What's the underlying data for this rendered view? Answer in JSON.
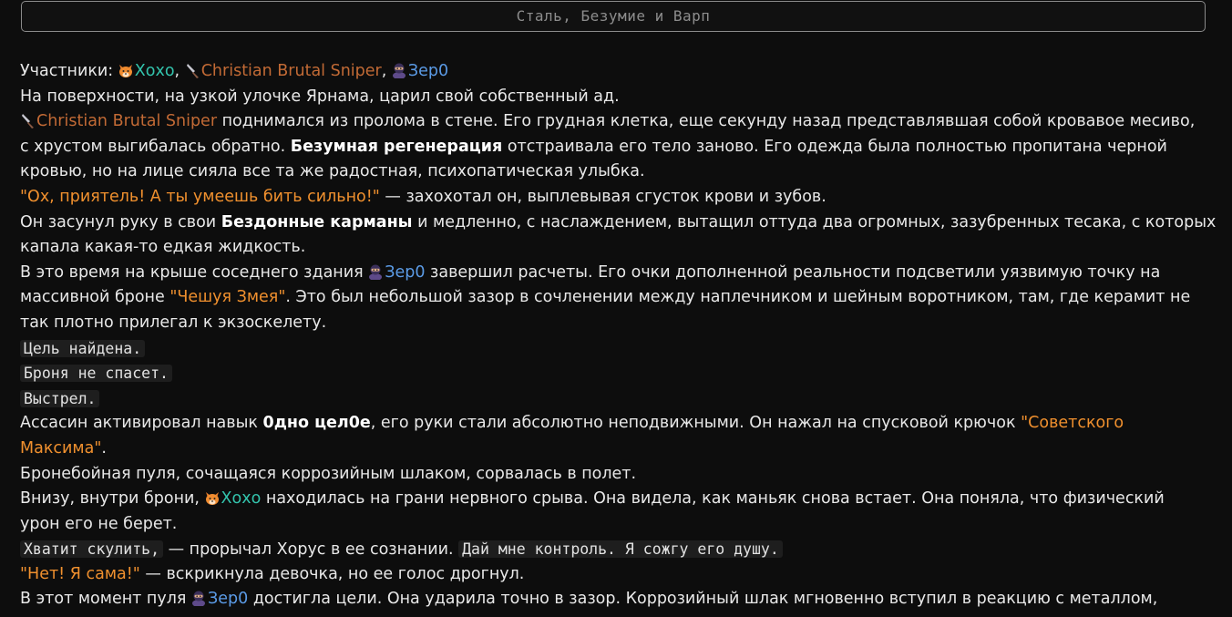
{
  "title": "Сталь, Безумие и Варп",
  "colors": {
    "teal": "#33c4ad",
    "brown": "#c26a35",
    "blue": "#5b9be6",
    "quote": "#f0902e",
    "background": "#0d0d0d"
  },
  "participants_label": "Участники:",
  "names": {
    "hoho": "Хохо",
    "cbs": "Christian Brutal Sniper",
    "zero": "Зер0"
  },
  "icons": {
    "hoho": "fox-icon",
    "cbs": "knife-icon",
    "zero": "ninja-icon"
  },
  "sep": ",",
  "l2": "На поверхности, на узкой улочке Ярнама, царил свой собственный ад.",
  "l3a": "поднимался из пролома в стене. Его грудная клетка, еще секунду назад представлявшая собой кровавое месиво,",
  "l4a": "с хрустом выгибалась обратно.",
  "l4b": "Безумная регенерация",
  "l4c": "отстраивала его тело заново. Его одежда была полностью пропитана черной",
  "l5": "кровью, но на лице сияла все та же радостная, психопатическая улыбка.",
  "l6q": "\"Ох, приятель! А ты умеешь бить сильно!\"",
  "l6b": "— захохотал он, выплевывая сгусток крови и зубов.",
  "l7a": "Он засунул руку в свои",
  "l7b": "Бездонные карманы",
  "l7c": "и медленно, с наслаждением, вытащил оттуда два огромных, зазубренных тесака, с которых",
  "l8": "капала какая-то едкая жидкость.",
  "l9a": "В это время на крыше соседнего здания",
  "l9b": "завершил расчеты. Его очки дополненной реальности подсветили уязвимую точку на",
  "l10a": "массивной броне",
  "l10q": "\"Чешуя Змея\"",
  "l10b": ". Это был небольшой зазор в сочленении между наплечником и шейным воротником, там, где керамит не",
  "l11": "так плотно прилегал к экзоскелету.",
  "code1": "Цель найдена.",
  "code2": "Броня не спасет.",
  "code3": "Выстрел.",
  "l15a": "Ассасин активировал навык",
  "l15b": "0дно цел0е",
  "l15c": ", его руки стали абсолютно неподвижными. Он нажал на спусковой крючок",
  "l15q": "\"Советского",
  "l16q": "Максима\"",
  "l16b": ".",
  "l17": "Бронебойная пуля, сочащаяся коррозийным шлаком, сорвалась в полет.",
  "l18a": "Внизу, внутри брони,",
  "l18b": "находилась на грани нервного срыва. Она видела, как маньяк снова встает. Она поняла, что физический",
  "l19": "урон его не берет.",
  "code4": "Хватит скулить,",
  "l20b": "— прорычал Хорус в ее сознании.",
  "code5": "Дай мне контроль. Я сожгу его душу.",
  "l21q": "\"Нет! Я сама!\"",
  "l21b": "— вскрикнула девочка, но ее голос дрогнул.",
  "l22a": "В этот момент пуля",
  "l22b": "достигла цели. Она ударила точно в зазор. Коррозийный шлак мгновенно вступил в реакцию с металлом,"
}
